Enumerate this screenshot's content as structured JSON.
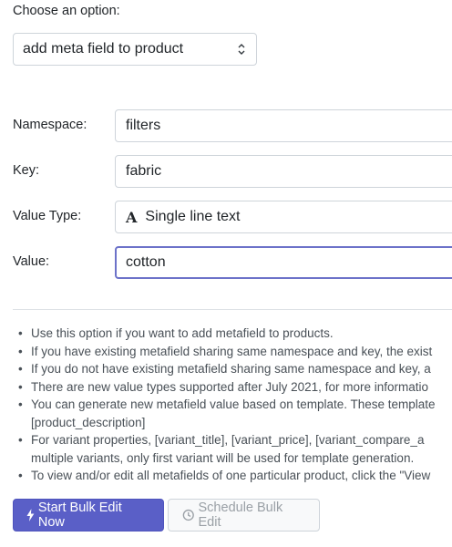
{
  "choose": {
    "label": "Choose an option:",
    "selected": "add meta field to product"
  },
  "form": {
    "namespace": {
      "label": "Namespace:",
      "value": "filters"
    },
    "key": {
      "label": "Key:",
      "value": "fabric"
    },
    "value_type": {
      "label": "Value Type:",
      "icon": "A",
      "value": "Single line text"
    },
    "value": {
      "label": "Value:",
      "value": "cotton"
    }
  },
  "notes": [
    "Use this option if you want to add metafield to products.",
    "If you have existing metafield sharing same namespace and key, the exist",
    "If you do not have existing metafield sharing same namespace and key, a",
    "There are new value types supported after July 2021, for more informatio",
    "You can generate new metafield value based on template. These template",
    "[product_description]",
    "For variant properties, [variant_title], [variant_price], [variant_compare_a",
    "multiple variants, only first variant will be used for template generation.",
    "To view and/or edit all metafields of one particular product, click the \"View"
  ],
  "buttons": {
    "start_label": "Start Bulk Edit Now",
    "schedule_label": "Schedule Bulk Edit"
  }
}
